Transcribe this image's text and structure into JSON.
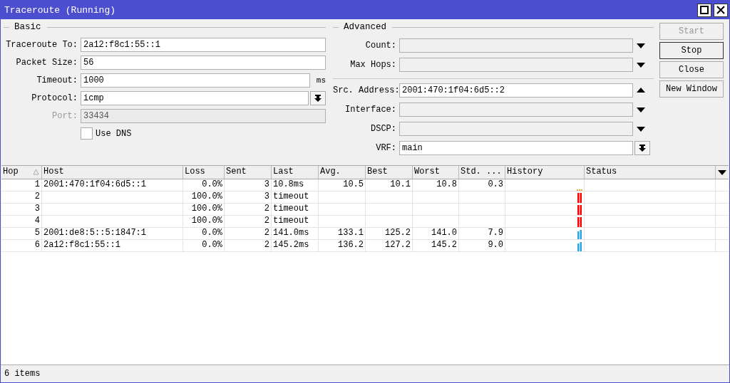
{
  "window": {
    "title": "Traceroute (Running)"
  },
  "basic": {
    "legend": "Basic",
    "fields": [
      {
        "label": "Traceroute To:",
        "value": "2a12:f8c1:55::1",
        "kind": "text",
        "disabled": false
      },
      {
        "label": "Packet Size:",
        "value": "56",
        "kind": "text",
        "disabled": false
      },
      {
        "label": "Timeout:",
        "value": "1000",
        "kind": "unit",
        "unit": "ms",
        "disabled": false
      },
      {
        "label": "Protocol:",
        "value": "icmp",
        "kind": "select",
        "disabled": false
      },
      {
        "label": "Port:",
        "value": "33434",
        "kind": "text",
        "disabled": true
      }
    ],
    "use_dns": {
      "label": "Use DNS",
      "checked": false
    }
  },
  "advanced": {
    "legend": "Advanced",
    "groups": [
      [
        {
          "label": "Count:",
          "kind": "down"
        },
        {
          "label": "Max Hops:",
          "kind": "down"
        }
      ],
      [
        {
          "label": "Src. Address:",
          "value": "2001:470:1f04:6d5::2",
          "kind": "up"
        },
        {
          "label": "Interface:",
          "kind": "down"
        },
        {
          "label": "DSCP:",
          "kind": "down"
        },
        {
          "label": "VRF:",
          "value": "main",
          "kind": "select"
        }
      ]
    ]
  },
  "buttons": [
    {
      "label": "Start",
      "disabled": true,
      "default": false
    },
    {
      "label": "Stop",
      "disabled": false,
      "default": true
    },
    {
      "label": "Close",
      "disabled": false,
      "default": false
    },
    {
      "label": "New Window",
      "disabled": false,
      "default": false
    }
  ],
  "table": {
    "columns": [
      "Hop",
      "Host",
      "Loss",
      "Sent",
      "Last",
      "Avg.",
      "Best",
      "Worst",
      "Std. ...",
      "History",
      "Status"
    ],
    "rows": [
      {
        "hop": "1",
        "host": "2001:470:1f04:6d5::1",
        "loss": "0.0%",
        "sent": "3",
        "last": "10.8ms",
        "avg": "10.5",
        "best": "10.1",
        "worst": "10.8",
        "std": "0.3",
        "history": {
          "kind": "dashes",
          "color": "#f5a623"
        }
      },
      {
        "hop": "2",
        "loss": "100.0%",
        "sent": "3",
        "last": "timeout",
        "history": {
          "kind": "full",
          "color": "#ff0000"
        }
      },
      {
        "hop": "3",
        "loss": "100.0%",
        "sent": "2",
        "last": "timeout",
        "history": {
          "kind": "full",
          "color": "#ff0000"
        }
      },
      {
        "hop": "4",
        "loss": "100.0%",
        "sent": "2",
        "last": "timeout",
        "history": {
          "kind": "full",
          "color": "#ff0000"
        }
      },
      {
        "hop": "5",
        "host": "2001:de8:5::5:1847:1",
        "loss": "0.0%",
        "sent": "2",
        "last": "141.0ms",
        "avg": "133.1",
        "best": "125.2",
        "worst": "141.0",
        "std": "7.9",
        "history": {
          "kind": "bars",
          "color": "#29a8e0"
        }
      },
      {
        "hop": "6",
        "host": "2a12:f8c1:55::1",
        "loss": "0.0%",
        "sent": "2",
        "last": "145.2ms",
        "avg": "136.2",
        "best": "127.2",
        "worst": "145.2",
        "std": "9.0",
        "history": {
          "kind": "bars",
          "color": "#29a8e0"
        }
      }
    ]
  },
  "status_bar": "6 items"
}
